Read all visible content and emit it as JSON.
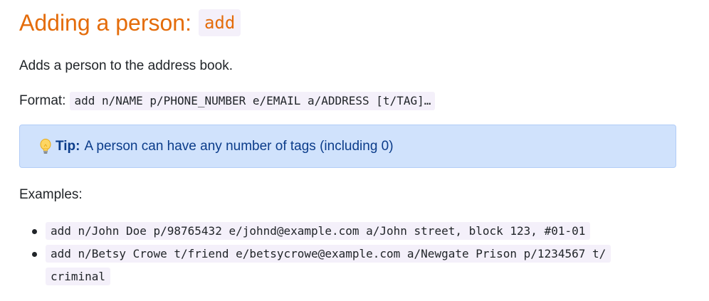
{
  "heading": {
    "text": "Adding a person:",
    "code": "add"
  },
  "intro": "Adds a person to the address book.",
  "format": {
    "label": "Format:",
    "code": "add n/NAME p/PHONE_NUMBER e/EMAIL a/ADDRESS [t/TAG]…"
  },
  "tip": {
    "icon": "lightbulb-icon",
    "label": "Tip:",
    "text": "A person can have any number of tags (including 0)"
  },
  "examples": {
    "label": "Examples:",
    "items": [
      {
        "code": "add n/John Doe p/98765432 e/johnd@example.com a/John street, block 123, #01-01"
      },
      {
        "code_line1": "add n/Betsy Crowe t/friend e/betsycrowe@example.com a/Newgate Prison p/1234567 t/",
        "code_line2": "criminal"
      }
    ]
  },
  "colors": {
    "heading": "#e46c0a",
    "code_bg": "#f4f0fa",
    "tip_bg": "#d0e2fc",
    "tip_border": "#b2cdf7",
    "tip_text": "#0b3c8a"
  }
}
